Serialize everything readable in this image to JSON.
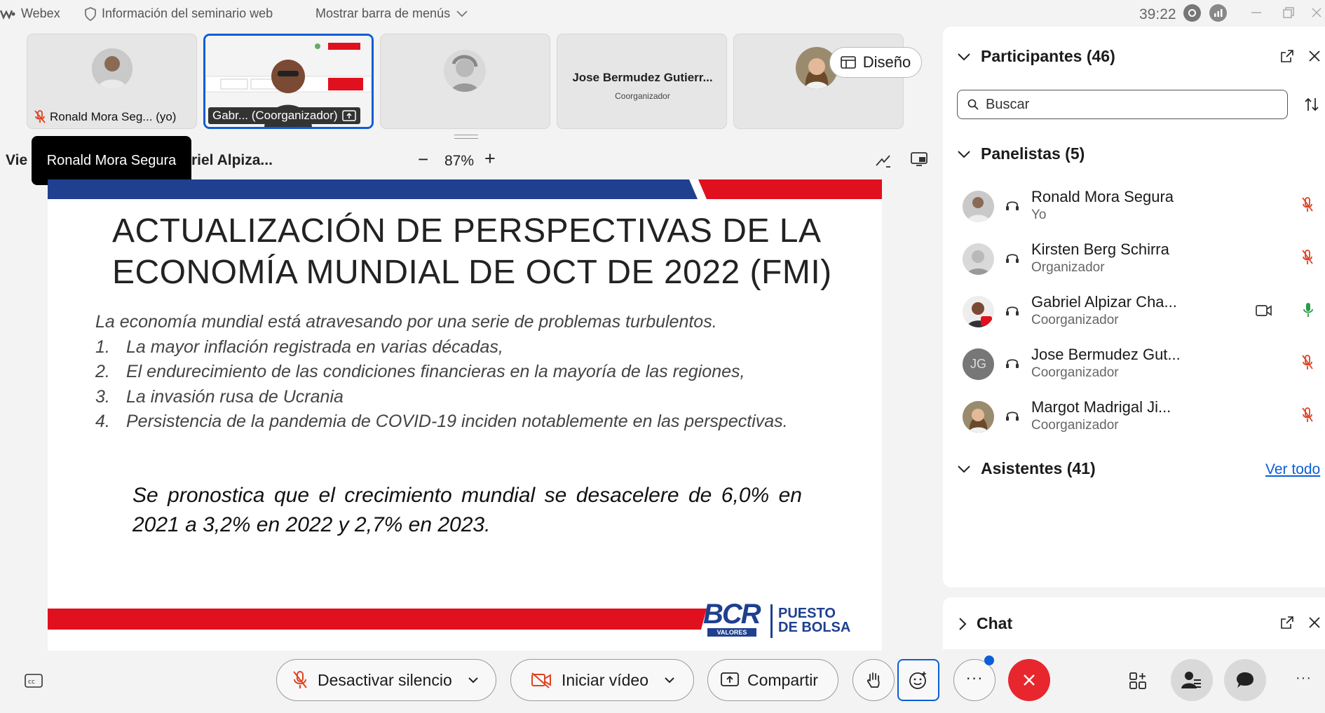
{
  "titlebar": {
    "app_name": "Webex",
    "seminar_info": "Información del seminario web",
    "menu_toggle": "Mostrar barra de menús",
    "timer": "39:22"
  },
  "thumbnails": [
    {
      "name": "Ronald Mora Seg... (yo)",
      "muted": true
    },
    {
      "name": "Gabr... (Coorganizador)",
      "active": true,
      "sharing": true
    },
    {
      "name": ""
    },
    {
      "name": "Jose Bermudez Gutierr...",
      "role": "Coorganizador"
    },
    {
      "name": ""
    }
  ],
  "layout_button": "Diseño",
  "tooltip": "Ronald Mora Segura",
  "viewer": {
    "left_label_start": "Vie",
    "left_label_end": "riel Alpiza...",
    "zoom": "87%",
    "zoom_minus": "−",
    "zoom_plus": "+"
  },
  "slide": {
    "title_line1": "ACTUALIZACIÓN DE PERSPECTIVAS DE LA",
    "title_line2": "ECONOMÍA MUNDIAL DE OCT DE 2022 (FMI)",
    "intro": "La economía mundial está atravesando por una serie de problemas turbulentos.",
    "items": [
      {
        "num": "1.",
        "text": "La mayor inflación registrada en varias décadas,"
      },
      {
        "num": "2.",
        "text": "El endurecimiento de las condiciones financieras en la mayoría de las regiones,"
      },
      {
        "num": "3.",
        "text": "La invasión rusa de Ucrania"
      },
      {
        "num": "4.",
        "text": "Persistencia de la pandemia de COVID-19 inciden notablemente en las perspectivas."
      }
    ],
    "forecast": "Se pronostica que el crecimiento mundial se desacelere de 6,0% en 2021 a 3,2% en 2022 y 2,7% en 2023.",
    "logo_bcr": "BCR",
    "logo_valores": "VALORES",
    "logo_puesto": "PUESTO",
    "logo_bolsa": "DE BOLSA",
    "colors": {
      "blue": "#1f3f8f",
      "red": "#e0101f"
    }
  },
  "panel": {
    "participants_title": "Participantes (46)",
    "search_placeholder": "Buscar",
    "panelists_title": "Panelistas (5)",
    "panelists": [
      {
        "name": "Ronald Mora Segura",
        "role": "Yo",
        "mic": "muted"
      },
      {
        "name": "Kirsten Berg Schirra",
        "role": "Organizador",
        "mic": "muted"
      },
      {
        "name": "Gabriel Alpizar Cha...",
        "role": "Coorganizador",
        "mic": "active",
        "video": true
      },
      {
        "name": "Jose Bermudez Gut...",
        "role": "Coorganizador",
        "mic": "muted",
        "initials": "JG"
      },
      {
        "name": "Margot Madrigal Ji...",
        "role": "Coorganizador",
        "mic": "muted"
      }
    ],
    "attendees_title": "Asistentes (41)",
    "view_all": "Ver todo",
    "chat_title": "Chat"
  },
  "controls": {
    "unmute": "Desactivar silencio",
    "start_video": "Iniciar vídeo",
    "share": "Compartir",
    "more": "···",
    "end_color": "#e8262d"
  }
}
